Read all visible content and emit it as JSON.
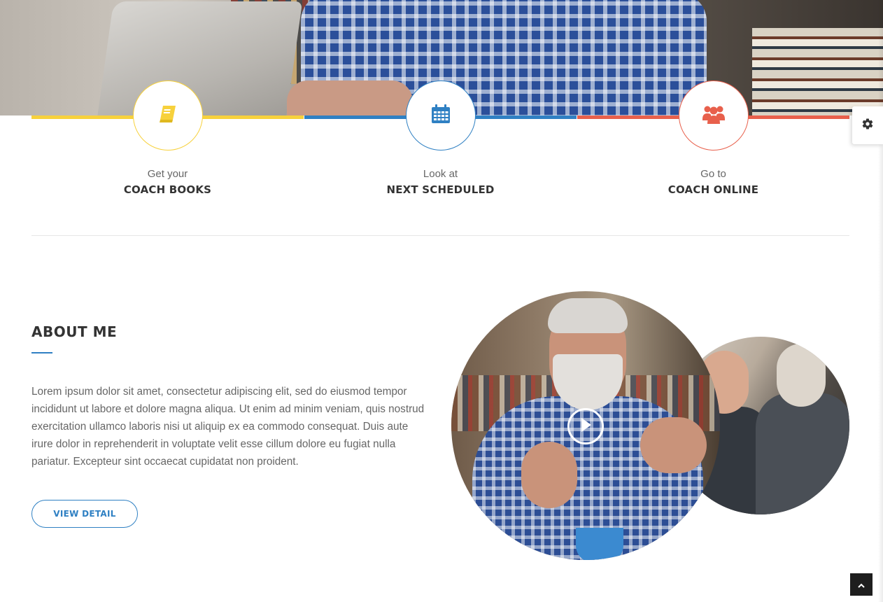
{
  "features": [
    {
      "pre": "Get your",
      "main": "COACH BOOKS",
      "icon": "book-icon",
      "color": "#f7d13c"
    },
    {
      "pre": "Look at",
      "main": "NEXT SCHEDULED",
      "icon": "calendar-icon",
      "color": "#2f80c3"
    },
    {
      "pre": "Go to",
      "main": "COACH ONLINE",
      "icon": "users-icon",
      "color": "#e8604c"
    }
  ],
  "about": {
    "title": "ABOUT ME",
    "text": "Lorem ipsum dolor sit amet, consectetur adipiscing elit, sed do eiusmod tempor incididunt ut labore et dolore magna aliqua. Ut enim ad minim veniam, quis nostrud exercitation ullamco laboris nisi ut aliquip ex ea commodo consequat. Duis aute irure dolor in reprehenderit in voluptate velit esse cillum dolore eu fugiat nulla pariatur. Excepteur sint occaecat cupidatat non proident.",
    "button": "VIEW DETAIL"
  },
  "icons": {
    "settings": "gear-icon",
    "back_to_top": "chevron-up-icon",
    "video": "play-icon"
  },
  "colors": {
    "accent": "#2f80c3",
    "yellow": "#f7d13c",
    "red": "#e8604c"
  }
}
